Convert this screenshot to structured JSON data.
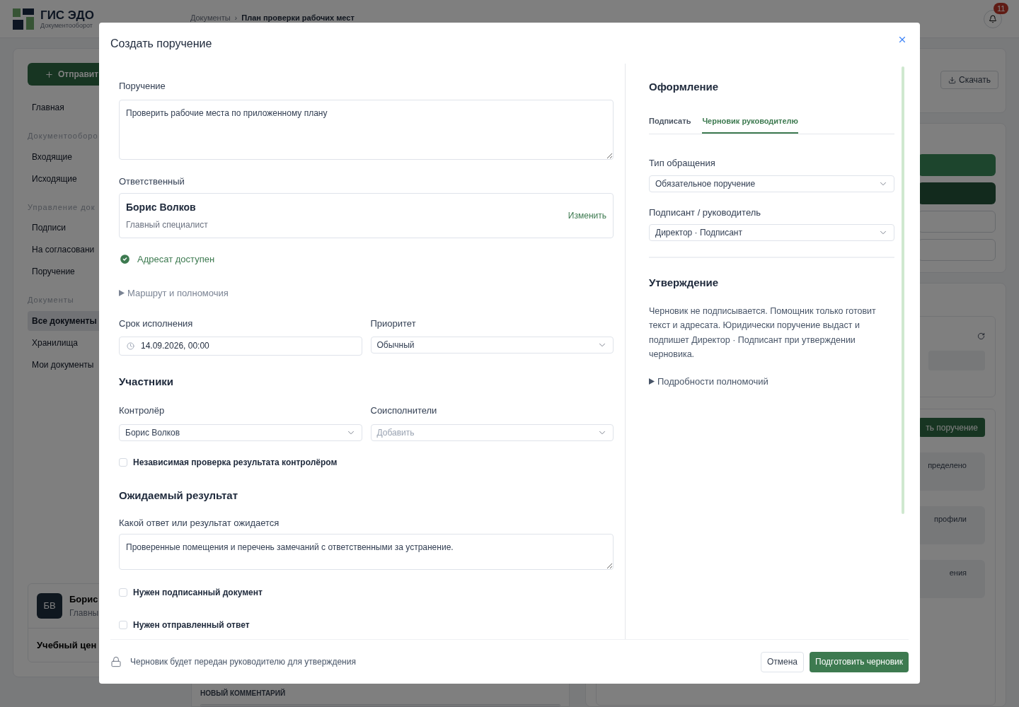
{
  "app": {
    "logo": {
      "title": "ГИС ЭДО",
      "subtitle": "Документооборот"
    },
    "breadcrumb": [
      {
        "label": "Документы",
        "current": false
      },
      {
        "label": "План проверки рабочих мест",
        "current": true
      }
    ],
    "breadcrumb_separator": "›",
    "notifications": {
      "count": "11"
    }
  },
  "sidebar": {
    "action_button": "Отправит",
    "sections": [
      {
        "items": [
          {
            "label": "Главная",
            "selected": false
          }
        ]
      },
      {
        "title": "Документооборо",
        "items": [
          {
            "label": "Входящие",
            "selected": false
          },
          {
            "label": "Исходящие",
            "selected": false
          }
        ]
      },
      {
        "title": "Управление док",
        "items": [
          {
            "label": "Подписи",
            "selected": false
          },
          {
            "label": "На согласовани",
            "selected": false
          },
          {
            "label": "Поручение",
            "selected": false
          }
        ]
      },
      {
        "title": "Документы",
        "items": [
          {
            "label": "Все документы",
            "selected": true
          },
          {
            "label": "Хранилища",
            "selected": false
          },
          {
            "label": "Мои документы",
            "selected": false
          }
        ]
      }
    ],
    "user_card": {
      "initials": "БВ",
      "name": "Борис",
      "role": "Главны"
    },
    "organization": "Учебный цен"
  },
  "right_panel": {
    "download_button": "Скачать",
    "task_button": "ть поручение",
    "cards": [
      "пределено",
      "профили",
      "ения"
    ]
  },
  "comment": {
    "label": "НОВЫЙ КОММЕНТАРИЙ"
  },
  "dialog": {
    "title": "Создать поручение",
    "task": {
      "label": "Поручение",
      "value": "Проверить рабочие места по приложенному плану"
    },
    "responsible": {
      "label": "Ответственный",
      "name": "Борис Волков",
      "position": "Главный специалист",
      "change_link": "Изменить"
    },
    "recipient_status": {
      "text": "Адресат доступен",
      "available": true
    },
    "route_toggle": {
      "label": "Маршрут и полномочия",
      "expanded": false
    },
    "deadline": {
      "label": "Срок исполнения",
      "value": "14.09.2026, 00:00"
    },
    "priority": {
      "label": "Приоритет",
      "value": "Обычный"
    },
    "participants": {
      "title": "Участники",
      "controller": {
        "label": "Контролёр",
        "value": "Борис Волков"
      },
      "coexecutors": {
        "label": "Соисполнители",
        "placeholder": "Добавить"
      }
    },
    "independent_check": {
      "label": "Независимая проверка результата контролёром",
      "checked": false
    },
    "expected_result": {
      "title": "Ожидаемый результат",
      "label": "Какой ответ или результат ожидается",
      "value": "Проверенные помещения и перечень замечаний с ответственными за устранение."
    },
    "requirements": [
      {
        "label": "Нужен подписанный документ",
        "checked": false
      },
      {
        "label": "Нужен отправленный ответ",
        "checked": false
      }
    ],
    "design": {
      "title": "Оформление",
      "tabs": [
        {
          "label": "Подписать",
          "selected": false
        },
        {
          "label": "Черновик руководителю",
          "selected": true
        }
      ],
      "request_type": {
        "label": "Тип обращения",
        "value": "Обязательное поручение"
      },
      "signer": {
        "label": "Подписант / руководитель",
        "value": "Директор · Подписант"
      }
    },
    "approval": {
      "title": "Утверждение",
      "text": "Черновик не подписывается. Помощник только готовит текст и адресата. Юридически поручение выдаст и подпишет Директор · Подписант при утверждении черновика.",
      "details_toggle": {
        "label": "Подробности полномочий",
        "expanded": false
      }
    },
    "footer": {
      "note": "Черновик будет передан руководителю для утверждения",
      "cancel": "Отмена",
      "submit": "Подготовить черновик"
    }
  }
}
